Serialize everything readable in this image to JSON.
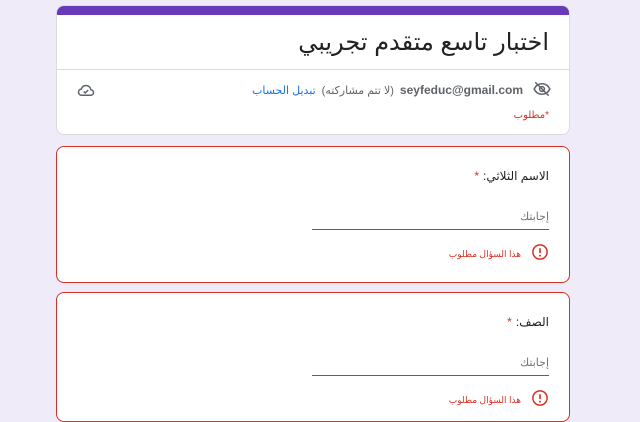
{
  "form": {
    "title": "اختبار تاسع متقدم تجريبي",
    "accent_color": "#673ab7",
    "error_color": "#d93025",
    "account": {
      "email": "seyfeduc@gmail.com",
      "not_shared_text": "(لا تتم مشاركته)",
      "switch_account_label": "تبديل الحساب"
    },
    "required_note": "*مطلوب",
    "icons": {
      "visibility": "eye-off-icon",
      "save_status": "cloud-done-icon",
      "error": "error-circle-icon"
    }
  },
  "questions": [
    {
      "label": "الاسم الثلاثي:",
      "required_mark": "*",
      "answer_value": "",
      "answer_placeholder": "إجابتك",
      "error_text": "هذا السؤال مطلوب"
    },
    {
      "label": "الصف:",
      "required_mark": "*",
      "answer_value": "",
      "answer_placeholder": "إجابتك",
      "error_text": "هذا السؤال مطلوب"
    }
  ]
}
